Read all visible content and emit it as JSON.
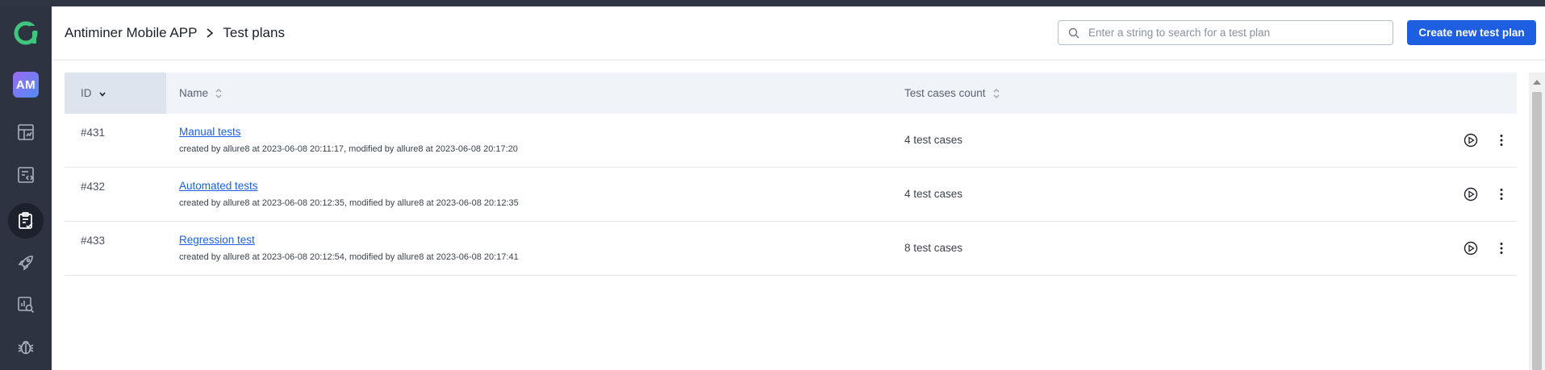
{
  "app": {
    "logo_icon": "allure-logo-icon",
    "avatar_initials": "AM"
  },
  "sidebar": {
    "items": [
      {
        "icon": "dashboards-icon",
        "active": false
      },
      {
        "icon": "test-cases-icon",
        "active": false
      },
      {
        "icon": "test-plans-icon",
        "active": true
      },
      {
        "icon": "launches-icon",
        "active": false
      },
      {
        "icon": "analytics-icon",
        "active": false
      },
      {
        "icon": "defects-icon",
        "active": false
      }
    ]
  },
  "header": {
    "project": "Antiminer Mobile APP",
    "page": "Test plans",
    "search_placeholder": "Enter a string to search for a test plan",
    "search_value": "",
    "create_label": "Create new test plan"
  },
  "table": {
    "columns": {
      "id": "ID",
      "name": "Name",
      "count": "Test cases count"
    },
    "sort": {
      "column": "ID",
      "direction": "desc"
    },
    "rows": [
      {
        "id": "#431",
        "name": "Manual tests",
        "meta": "created by allure8 at 2023-06-08 20:11:17, modified by allure8 at 2023-06-08 20:17:20",
        "count": "4 test cases"
      },
      {
        "id": "#432",
        "name": "Automated tests",
        "meta": "created by allure8 at 2023-06-08 20:12:35, modified by allure8 at 2023-06-08 20:12:35",
        "count": "4 test cases"
      },
      {
        "id": "#433",
        "name": "Regression test",
        "meta": "created by allure8 at 2023-06-08 20:12:54, modified by allure8 at 2023-06-08 20:17:41",
        "count": "8 test cases"
      }
    ]
  },
  "colors": {
    "accent": "#1d5fe0",
    "sidebar": "#2d3341",
    "logo": "#3fc57e"
  }
}
